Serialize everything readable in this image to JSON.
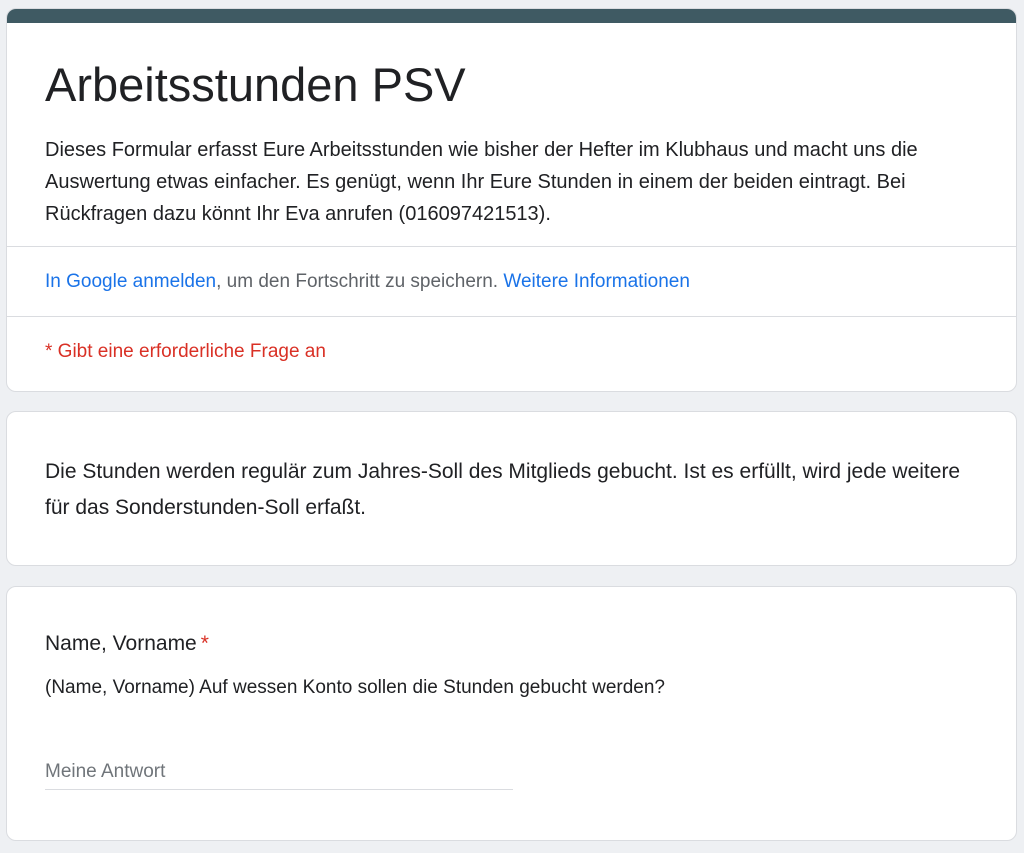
{
  "form": {
    "title": "Arbeitsstunden PSV",
    "description": "Dieses Formular erfasst Eure Arbeitsstunden wie bisher der Hefter im Klubhaus und macht uns die Auswertung etwas einfacher. Es genügt, wenn Ihr Eure Stunden in einem der beiden eintragt. Bei Rückfragen dazu könnt Ihr Eva anrufen (016097421513).",
    "accent_color": "#3f5a63",
    "signin": {
      "link_label": "In Google anmelden",
      "text": ", um den Fortschritt zu speichern. ",
      "more_info_label": "Weitere Informationen"
    },
    "required_note": "* Gibt eine erforderliche Frage an"
  },
  "info_section": {
    "text": "Die Stunden werden regulär zum Jahres-Soll des Mitglieds gebucht. Ist es erfüllt, wird jede weitere für das Sonderstunden-Soll erfaßt."
  },
  "question": {
    "title": "Name, Vorname",
    "required_mark": "*",
    "description": "(Name, Vorname) Auf wessen Konto sollen die Stunden gebucht werden?",
    "placeholder": "Meine Antwort",
    "value": ""
  }
}
